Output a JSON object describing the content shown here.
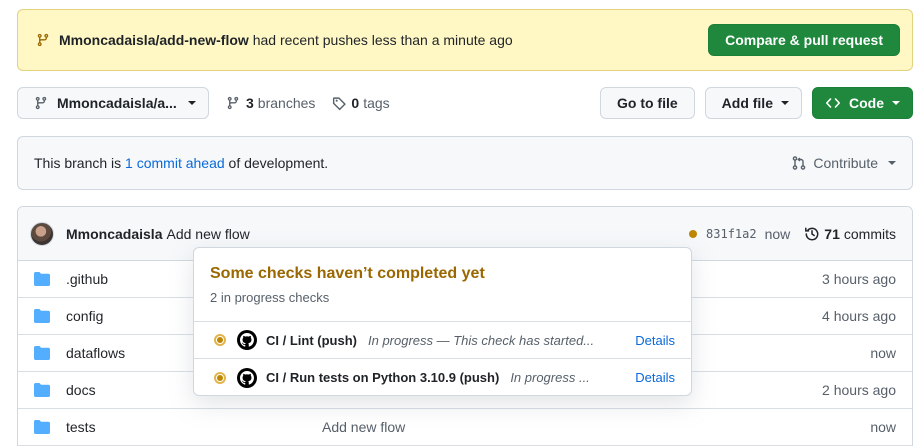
{
  "banner": {
    "branch": "Mmoncadaisla/add-new-flow",
    "message": " had recent pushes less than a minute ago",
    "button": "Compare & pull request"
  },
  "toolbar": {
    "branch_name": "Mmoncadaisla/a...",
    "branches_count": "3",
    "branches_label": "branches",
    "tags_count": "0",
    "tags_label": "tags",
    "goto_file": "Go to file",
    "add_file": "Add file",
    "code": "Code"
  },
  "ahead": {
    "prefix": "This branch is ",
    "link": "1 commit ahead",
    "suffix": " of development.",
    "contribute": "Contribute"
  },
  "commit": {
    "author": "Mmoncadaisla",
    "message": "Add new flow",
    "sha": "831f1a2",
    "time": "now",
    "commits_count": "71",
    "commits_label": "commits"
  },
  "files": [
    {
      "name": ".github",
      "message": "",
      "time": "3 hours ago"
    },
    {
      "name": "config",
      "message": "",
      "time": "4 hours ago"
    },
    {
      "name": "dataflows",
      "message": "",
      "time": "now"
    },
    {
      "name": "docs",
      "message": "",
      "time": "2 hours ago"
    },
    {
      "name": "tests",
      "message": "Add new flow",
      "time": "now"
    }
  ],
  "popover": {
    "title": "Some checks haven’t completed yet",
    "subtitle": "2 in progress checks",
    "checks": [
      {
        "name": "CI / Lint (push)",
        "status": "In progress — This check has started...",
        "details": "Details"
      },
      {
        "name": "CI / Run tests on Python 3.10.9 (push)",
        "status": "In progress ...",
        "details": "Details"
      }
    ]
  },
  "colors": {
    "banner_bg": "#fff8c5",
    "primary_green": "#1f883d",
    "link_blue": "#0969da",
    "pending": "#bf8700",
    "folder": "#54aeff"
  }
}
